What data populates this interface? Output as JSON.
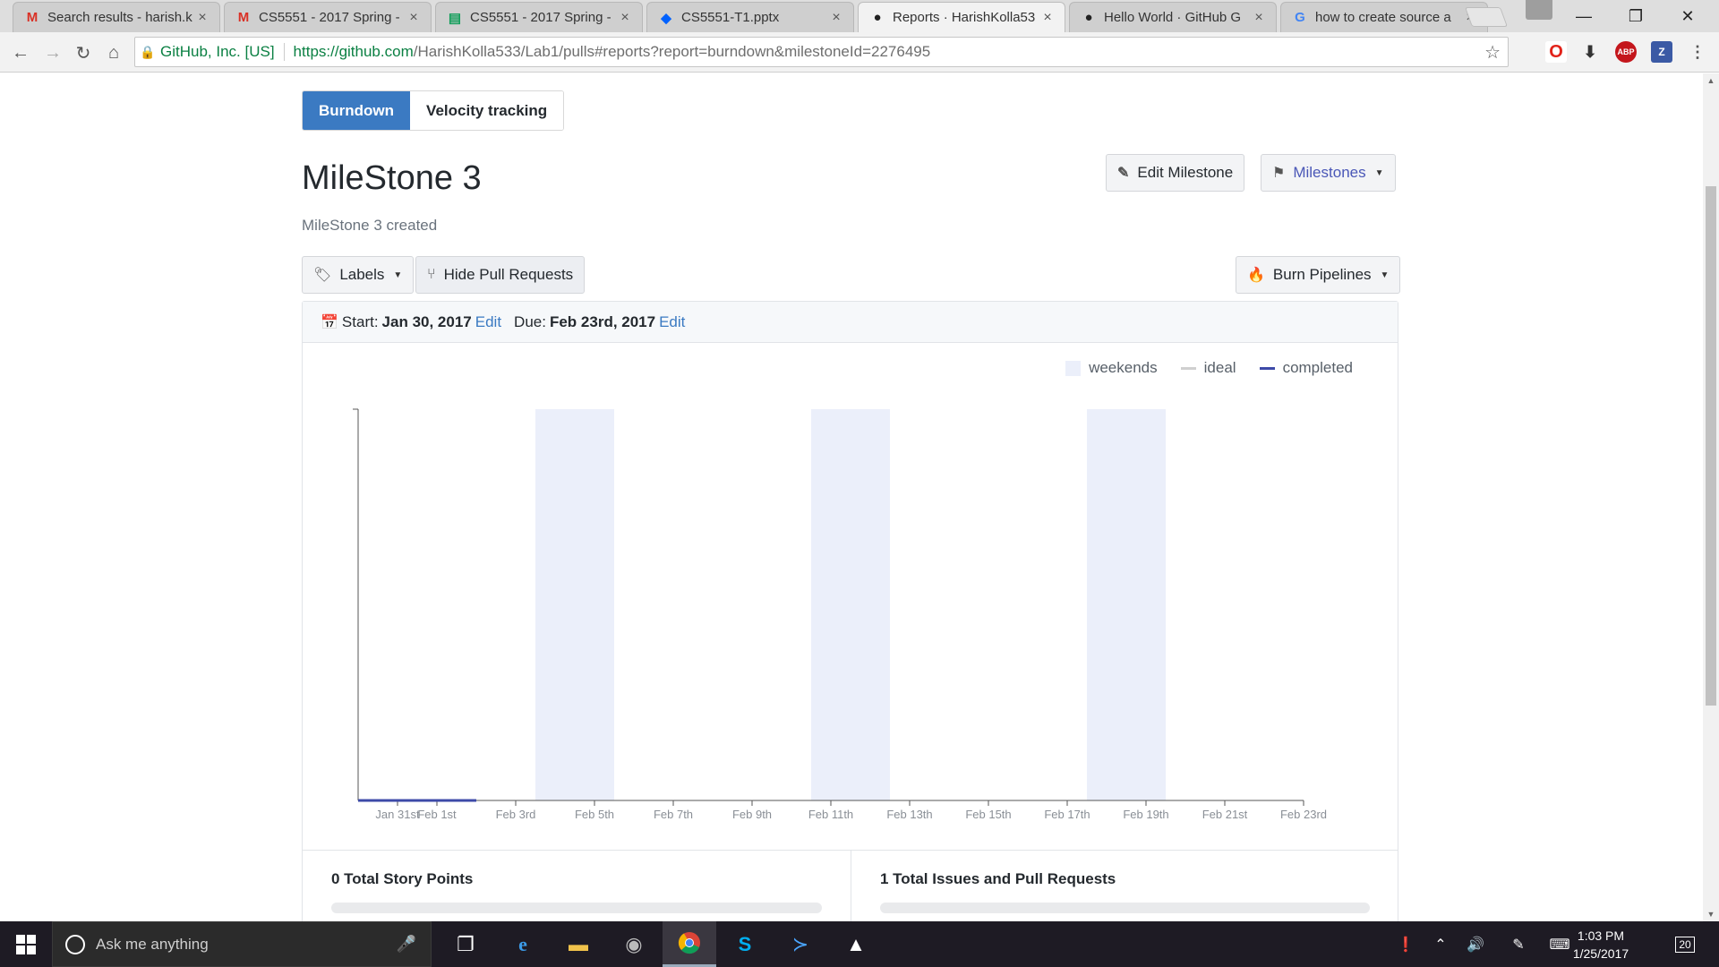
{
  "browser": {
    "tabs": [
      {
        "title": "Search results - harish.k",
        "icon": "gmail-icon",
        "active": false
      },
      {
        "title": "CS5551 - 2017 Spring -",
        "icon": "gmail-icon",
        "active": false
      },
      {
        "title": "CS5551 - 2017 Spring -",
        "icon": "sheets-icon",
        "active": false
      },
      {
        "title": "CS5551-T1.pptx",
        "icon": "dropbox-icon",
        "active": false
      },
      {
        "title": "Reports · HarishKolla53",
        "icon": "github-icon",
        "active": true
      },
      {
        "title": "Hello World · GitHub G",
        "icon": "github-icon",
        "active": false
      },
      {
        "title": "how to create source a",
        "icon": "google-icon",
        "active": false
      }
    ],
    "omnibox": {
      "secure_label": "GitHub, Inc. [US]",
      "url_host": "https://github.com",
      "url_path": "/HarishKolla533/Lab1/pulls#reports?report=burndown&milestoneId=2276495"
    }
  },
  "page": {
    "tabs": {
      "burndown": "Burndown",
      "velocity": "Velocity tracking"
    },
    "milestone": {
      "title": "MileStone 3",
      "description": "MileStone 3 created"
    },
    "buttons": {
      "edit_milestone": "Edit Milestone",
      "milestones": "Milestones",
      "labels": "Labels",
      "hide_prs": "Hide Pull Requests",
      "burn_pipelines": "Burn Pipelines"
    },
    "dates": {
      "start_label": "Start:",
      "start": "Jan 30, 2017",
      "due_label": "Due:",
      "due": "Feb 23rd, 2017",
      "edit": "Edit"
    },
    "legend": {
      "weekends": "weekends",
      "ideal": "ideal",
      "completed": "completed"
    },
    "stats": {
      "story_points": "0 Total Story Points",
      "issues": "1 Total Issues and Pull Requests"
    }
  },
  "chart_data": {
    "type": "line",
    "x_tick_labels": [
      "Jan 31st",
      "Feb 1st",
      "Feb 3rd",
      "Feb 5th",
      "Feb 7th",
      "Feb 9th",
      "Feb 11th",
      "Feb 13th",
      "Feb 15th",
      "Feb 17th",
      "Feb 19th",
      "Feb 21st",
      "Feb 23rd"
    ],
    "x_tick_days": [
      1,
      2,
      4,
      6,
      8,
      10,
      12,
      14,
      16,
      18,
      20,
      22,
      24
    ],
    "x_range_days": [
      0,
      24
    ],
    "weekend_spans_days": [
      [
        4.5,
        6.5
      ],
      [
        11.5,
        13.5
      ],
      [
        18.5,
        20.5
      ]
    ],
    "series": [
      {
        "name": "completed",
        "color": "#3d4aa8",
        "x_days": [
          0,
          3
        ],
        "y": [
          0,
          0
        ]
      },
      {
        "name": "ideal",
        "color": "#d0d0d0",
        "x_days": [],
        "y": []
      }
    ],
    "legend_position": "top-right",
    "colors": {
      "weekend": "#ebeffa",
      "axis": "#555555",
      "tick_text": "#8a8f96"
    }
  },
  "taskbar": {
    "search_placeholder": "Ask me anything",
    "time": "1:03 PM",
    "date": "1/25/2017",
    "notification_count": "20"
  }
}
